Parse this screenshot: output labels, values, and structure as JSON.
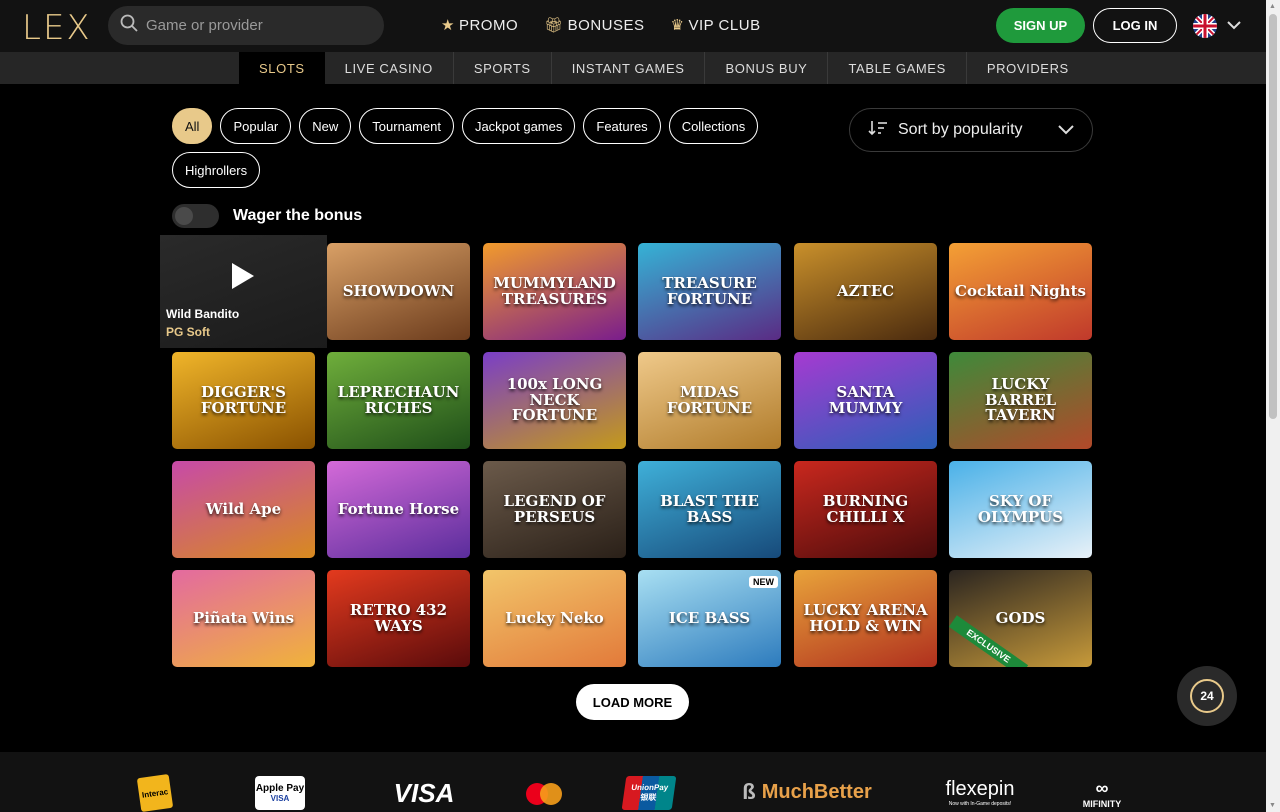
{
  "header": {
    "logo": "LEX",
    "search_placeholder": "Game or provider",
    "nav": [
      {
        "label": "PROMO",
        "icon": "star-icon"
      },
      {
        "label": "BONUSES",
        "icon": "gift-icon"
      },
      {
        "label": "VIP CLUB",
        "icon": "crown-icon"
      }
    ],
    "signup_label": "SIGN UP",
    "login_label": "LOG IN",
    "language_icon": "uk-flag-icon"
  },
  "subnav": [
    "SLOTS",
    "LIVE CASINO",
    "SPORTS",
    "INSTANT GAMES",
    "BONUS BUY",
    "TABLE GAMES",
    "PROVIDERS"
  ],
  "filters": [
    "All",
    "Popular",
    "New",
    "Tournament",
    "Jackpot games",
    "Features",
    "Collections",
    "Highrollers"
  ],
  "active_filter": "All",
  "sort_label": "Sort by popularity",
  "wager_label": "Wager the bonus",
  "wager_enabled": false,
  "hovered_game": {
    "name": "Wild Bandito",
    "provider": "PG Soft"
  },
  "games": [
    {
      "title": "",
      "colors": [
        "#2a2a2a",
        "#1b1b1b"
      ]
    },
    {
      "title": "SHOWDOWN",
      "colors": [
        "#d9a066",
        "#6b3b1c"
      ]
    },
    {
      "title": "MUMMYLAND TREASURES",
      "colors": [
        "#f29b2c",
        "#7a1d8c"
      ]
    },
    {
      "title": "TREASURE FORTUNE",
      "colors": [
        "#35b3d6",
        "#5a2b84"
      ]
    },
    {
      "title": "AZTEC",
      "colors": [
        "#c9902b",
        "#4a2a0e"
      ]
    },
    {
      "title": "Cocktail Nights",
      "colors": [
        "#f4a035",
        "#c0392b"
      ]
    },
    {
      "title": "DIGGER'S FORTUNE",
      "colors": [
        "#f0b52a",
        "#8a5200"
      ]
    },
    {
      "title": "LEPRECHAUN RICHES",
      "colors": [
        "#6fae3b",
        "#1f4f19"
      ]
    },
    {
      "title": "100x LONG NECK FORTUNE",
      "colors": [
        "#7a3ec7",
        "#c49a1a"
      ]
    },
    {
      "title": "MIDAS FORTUNE",
      "colors": [
        "#efc98a",
        "#b07b2a"
      ]
    },
    {
      "title": "SANTA MUMMY",
      "colors": [
        "#a63ad1",
        "#2b5fb8"
      ]
    },
    {
      "title": "LUCKY BARREL TAVERN",
      "colors": [
        "#3e8a3a",
        "#b2492a"
      ]
    },
    {
      "title": "Wild Ape",
      "colors": [
        "#c74aa8",
        "#d88a1f"
      ]
    },
    {
      "title": "Fortune Horse",
      "colors": [
        "#d46ad8",
        "#5a2d9c"
      ]
    },
    {
      "title": "LEGEND OF PERSEUS",
      "colors": [
        "#6b5a4a",
        "#2a2018"
      ]
    },
    {
      "title": "BLAST THE BASS",
      "colors": [
        "#3fb0d9",
        "#174a7a"
      ]
    },
    {
      "title": "BURNING CHILLI X",
      "colors": [
        "#c9281e",
        "#4a0b0b"
      ]
    },
    {
      "title": "SKY OF OLYMPUS",
      "colors": [
        "#4ab1e8",
        "#e8f1f8"
      ]
    },
    {
      "title": "Piñata Wins",
      "colors": [
        "#e36aa0",
        "#f0b33a"
      ]
    },
    {
      "title": "RETRO 432 WAYS",
      "colors": [
        "#e33a1e",
        "#5a0b0b"
      ]
    },
    {
      "title": "Lucky Neko",
      "colors": [
        "#f2c56a",
        "#e27a3a"
      ]
    },
    {
      "title": "ICE BASS",
      "colors": [
        "#a8dff2",
        "#2d7bbd"
      ],
      "badge": "NEW"
    },
    {
      "title": "LUCKY ARENA HOLD & WIN",
      "colors": [
        "#e8a23a",
        "#b0301e"
      ]
    },
    {
      "title": "GODS",
      "colors": [
        "#2b2520",
        "#c79a3a"
      ],
      "badge": "EXCLUSIVE"
    }
  ],
  "load_more_label": "LOAD MORE",
  "support_label": "24",
  "payments": [
    {
      "name": "Interac",
      "icon": "interac-icon"
    },
    {
      "name": "Apple Pay",
      "icon": "apple-pay-icon",
      "sub": "VISA"
    },
    {
      "name": "VISA",
      "icon": "visa-icon"
    },
    {
      "name": "",
      "icon": "mastercard-icon"
    },
    {
      "name": "UnionPay",
      "icon": "unionpay-icon",
      "sub": "银联"
    },
    {
      "name": "MuchBetter",
      "icon": "muchbetter-icon"
    },
    {
      "name": "flexepin",
      "icon": "flexepin-icon",
      "sub": "Now with In-Game deposits!"
    },
    {
      "name": "MIFINITY",
      "icon": "mifinity-icon"
    }
  ]
}
